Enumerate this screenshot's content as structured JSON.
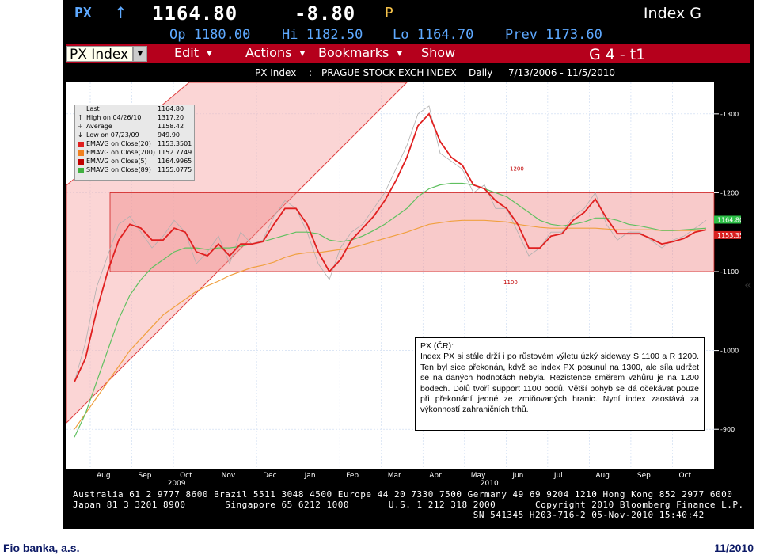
{
  "header": {
    "ticker": "PX",
    "arrow": "↑",
    "last": "1164.80",
    "change": "-8.80",
    "flag": "P",
    "security": "Index G"
  },
  "quote": {
    "open": "Op 1180.00",
    "high": "Hi 1182.50",
    "low": "Lo 1164.70",
    "prev": "Prev 1173.60"
  },
  "menu": {
    "security_field": "PX Index",
    "items": [
      "Edit",
      "Actions",
      "Bookmarks",
      "Show"
    ],
    "page": "G 4 - t1"
  },
  "chart_title": {
    "name": "PX Index",
    "sep": ":",
    "exchange": "PRAGUE STOCK EXCH INDEX",
    "freq": "Daily",
    "range": "7/13/2006 - 11/5/2010"
  },
  "legend": [
    {
      "name": "Last",
      "value": "1164.80",
      "color": "#ffffff",
      "icon": "none"
    },
    {
      "name": "High on 04/26/10",
      "value": "1317.20",
      "color": "#000000",
      "icon": "up-marker-icon"
    },
    {
      "name": "Average",
      "value": "1158.42",
      "color": "#555555",
      "icon": "average-marker-icon"
    },
    {
      "name": "Low on 07/23/09",
      "value": "949.90",
      "color": "#000000",
      "icon": "down-marker-icon"
    },
    {
      "name": "EMAVG on Close(20)",
      "value": "1153.3501",
      "color": "#e02020",
      "icon": "swatch"
    },
    {
      "name": "EMAVG on Close(200)",
      "value": "1152.7749",
      "color": "#f08020",
      "icon": "swatch"
    },
    {
      "name": "EMAVG on Close(5)",
      "value": "1164.9965",
      "color": "#c00000",
      "icon": "swatch"
    },
    {
      "name": "SMAVG on Close(89)",
      "value": "1155.0775",
      "color": "#40b040",
      "icon": "swatch"
    }
  ],
  "chart_data": {
    "type": "line",
    "x_labels": [
      "Aug",
      "Sep",
      "Oct",
      "Nov",
      "Dec",
      "Jan",
      "Feb",
      "Mar",
      "Apr",
      "May",
      "Jun",
      "Jul",
      "Aug",
      "Sep",
      "Oct"
    ],
    "years": [
      "2009",
      "2010"
    ],
    "y_ticks": [
      1300,
      1200,
      1100,
      1000,
      900
    ],
    "ylim": [
      850,
      1340
    ],
    "annotations": [
      "1200",
      "1100"
    ],
    "price_tags": [
      "1164.80",
      "1153.35"
    ],
    "series": [
      {
        "name": "Last",
        "color": "#e8e8e8",
        "values": [
          960,
          1010,
          1080,
          1120,
          1160,
          1170,
          1150,
          1130,
          1145,
          1165,
          1150,
          1110,
          1125,
          1145,
          1110,
          1150,
          1135,
          1140,
          1170,
          1190,
          1180,
          1150,
          1110,
          1090,
          1130,
          1150,
          1160,
          1180,
          1200,
          1230,
          1260,
          1300,
          1310,
          1250,
          1240,
          1230,
          1200,
          1210,
          1180,
          1180,
          1150,
          1120,
          1130,
          1150,
          1150,
          1170,
          1180,
          1200,
          1160,
          1140,
          1150,
          1150,
          1140,
          1130,
          1140,
          1145,
          1155,
          1165
        ]
      },
      {
        "name": "EMAVG on Close(200)",
        "color": "#f0a040",
        "values": [
          900,
          920,
          940,
          960,
          980,
          1000,
          1015,
          1030,
          1045,
          1055,
          1065,
          1075,
          1082,
          1088,
          1095,
          1100,
          1105,
          1108,
          1112,
          1118,
          1122,
          1124,
          1124,
          1126,
          1128,
          1130,
          1134,
          1138,
          1142,
          1146,
          1150,
          1155,
          1160,
          1162,
          1164,
          1165,
          1165,
          1165,
          1164,
          1163,
          1160,
          1158,
          1156,
          1155,
          1155,
          1155,
          1155,
          1155,
          1154,
          1153,
          1153,
          1153,
          1153,
          1152,
          1152,
          1152,
          1152,
          1153
        ]
      },
      {
        "name": "SMAVG on Close(89)",
        "color": "#60c060",
        "values": [
          890,
          920,
          960,
          1000,
          1040,
          1070,
          1090,
          1105,
          1115,
          1125,
          1130,
          1130,
          1128,
          1130,
          1130,
          1132,
          1135,
          1138,
          1142,
          1146,
          1150,
          1150,
          1148,
          1140,
          1138,
          1140,
          1145,
          1152,
          1160,
          1170,
          1180,
          1195,
          1205,
          1210,
          1212,
          1212,
          1210,
          1205,
          1200,
          1195,
          1185,
          1175,
          1165,
          1160,
          1158,
          1160,
          1163,
          1168,
          1168,
          1165,
          1160,
          1158,
          1155,
          1152,
          1152,
          1153,
          1154,
          1155
        ]
      },
      {
        "name": "EMAVG on Close(20)",
        "color": "#e02020",
        "values": [
          960,
          990,
          1050,
          1100,
          1140,
          1160,
          1155,
          1140,
          1140,
          1155,
          1150,
          1125,
          1120,
          1135,
          1120,
          1135,
          1135,
          1138,
          1160,
          1180,
          1180,
          1160,
          1125,
          1100,
          1115,
          1140,
          1155,
          1170,
          1190,
          1215,
          1245,
          1285,
          1300,
          1265,
          1245,
          1235,
          1210,
          1205,
          1190,
          1180,
          1160,
          1130,
          1130,
          1145,
          1148,
          1165,
          1175,
          1192,
          1168,
          1148,
          1148,
          1148,
          1142,
          1135,
          1138,
          1142,
          1150,
          1153
        ]
      }
    ]
  },
  "comment": {
    "title": "PX (ČR):",
    "text": "Index PX si stále drží i po růstovém výletu úzký sideway S 1100 a R 1200. Ten byl sice překonán, když se index PX posunul na 1300, ale síla udržet se na daných hodnotách nebyla. Rezistence směrem vzhůru je na 1200 bodech. Dolů tvoří support 1100 bodů. Větší pohyb se dá očekávat pouze při překonání jedné ze zmiňovaných hranic. Nyní index zaostává za výkonností zahraničních trhů."
  },
  "footer_lines": [
    "Australia 61 2 9777 8600 Brazil 5511 3048 4500 Europe 44 20 7330 7500 Germany 49 69 9204 1210 Hong Kong 852 2977 6000",
    "Japan 81 3 3201 8900       Singapore 65 6212 1000       U.S. 1 212 318 2000       Copyright 2010 Bloomberg Finance L.P.",
    "                                                                       SN 541345 H203-716-2 05-Nov-2010 15:40:42"
  ],
  "side_chevron": "«",
  "page_footer": {
    "left": "Fio banka, a.s.",
    "right": "11/2010"
  }
}
